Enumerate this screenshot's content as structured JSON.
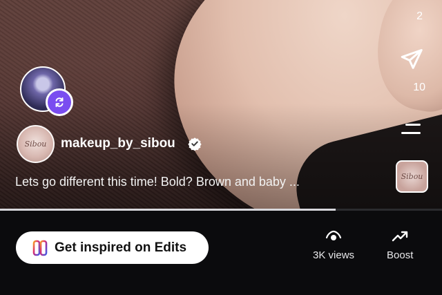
{
  "post": {
    "username": "makeup_by_sibou",
    "caption": "Lets go different this time! Bold? Brown and baby ...",
    "profile_logo_text": "Sibou"
  },
  "actions": {
    "top_count": "2",
    "share_count": "10"
  },
  "playback": {
    "progress_fraction": 0.76
  },
  "bottom_bar": {
    "edits_label": "Get inspired on Edits",
    "views_label": "3K views",
    "boost_label": "Boost"
  },
  "colors": {
    "remix_badge": "#7a4df0",
    "edits_gradient": [
      "#f5a623",
      "#e1306c",
      "#833ab4",
      "#405de6"
    ]
  },
  "icons": [
    "remix-icon",
    "verified-icon",
    "send-icon",
    "menu-icon",
    "edits-logo-icon",
    "eye-icon",
    "trending-up-icon"
  ]
}
